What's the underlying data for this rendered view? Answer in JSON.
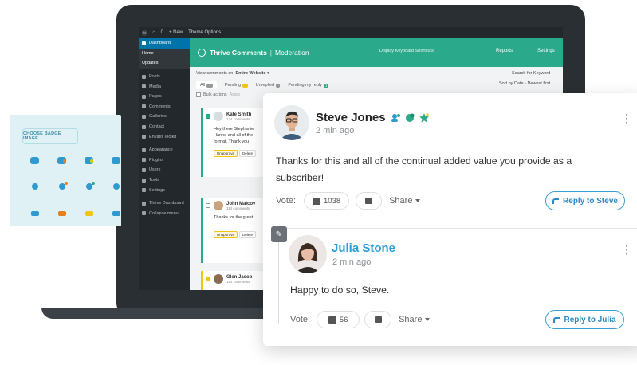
{
  "adminbar": {
    "items": [
      "Ⓦ",
      "⌂",
      "0",
      "+ New",
      "Theme Options"
    ]
  },
  "wp_sidebar": {
    "dashboard": "Dashboard",
    "sub": [
      "Home",
      "Updates"
    ],
    "items": [
      "Posts",
      "Media",
      "Pages",
      "Comments",
      "Galleries",
      "Contact",
      "Envato Toolkit",
      "Appearance",
      "Plugins",
      "Users",
      "Tools",
      "Settings",
      "Thrive Dashboard",
      "Collapse menu"
    ]
  },
  "tc_header": {
    "brand": "Thrive Comments",
    "section": "Moderation",
    "keyboard": "Display Keyboard Shortcuts",
    "reports": "Reports",
    "settings": "Settings"
  },
  "moderation": {
    "view_label": "View comments on",
    "view_value": "Entire Website",
    "search": "Search for Keyword",
    "sort": "Sort by  Date - Newest first",
    "tabs": [
      {
        "label": "All",
        "count": ""
      },
      {
        "label": "Pending",
        "count": ""
      },
      {
        "label": "Unreplied",
        "count": ""
      },
      {
        "label": "Pending my reply",
        "count": "1"
      }
    ],
    "bulk": "Bulk actions",
    "bulk_apply": "Apply",
    "cards": [
      {
        "name": "Kate Smith",
        "meta": "124 comments",
        "text": "Hey there Stephanie Hanne and all of the format. Thank you",
        "tag": "Unapprove",
        "del": "Delete"
      },
      {
        "name": "John Malcov",
        "meta": "114 comments",
        "text": "Thanks for the great",
        "tag": "Unapprove",
        "del": "Delete"
      },
      {
        "name": "Glen Jacob",
        "meta": "124 comments",
        "text": "",
        "tag": "",
        "del": ""
      }
    ]
  },
  "badge_panel": {
    "title": "CHOOSE BADGE IMAGE"
  },
  "comment": {
    "author": "Steve Jones",
    "time": "2 min ago",
    "text": "Thanks for this and all of the continual added value you provide as a subscriber!",
    "vote_label": "Vote:",
    "upvotes": "1038",
    "share": "Share",
    "reply": "Reply to Steve"
  },
  "reply": {
    "author": "Julia Stone",
    "time": "2 min ago",
    "text": "Happy to do so, Steve.",
    "vote_label": "Vote:",
    "upvotes": "56",
    "share": "Share",
    "reply": "Reply to Julia"
  },
  "colors": {
    "brand": "#2aa98b",
    "link": "#2a9fd8",
    "badge_blue": "#2f9ad0"
  }
}
